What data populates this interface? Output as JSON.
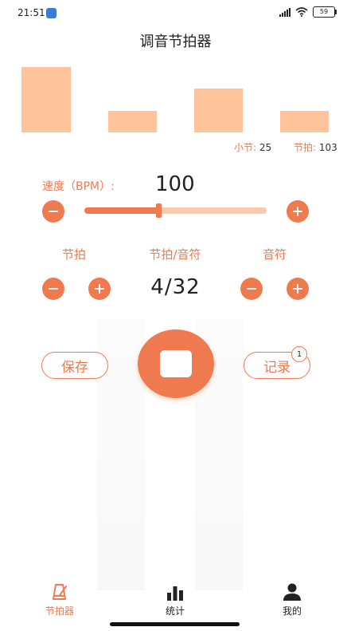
{
  "status_bar": {
    "time": "21:51",
    "battery": "59"
  },
  "page_title": "调音节拍器",
  "beat_bars": [
    {
      "level": 1.0
    },
    {
      "level": 0.33
    },
    {
      "level": 0.67
    },
    {
      "level": 0.33
    }
  ],
  "meta": {
    "measure_label": "小节:",
    "measure_value": "25",
    "beat_label": "节拍:",
    "beat_value": "103"
  },
  "speed": {
    "label": "速度（BPM）:",
    "value": "100",
    "slider_fraction": 0.41
  },
  "sections": {
    "beat_label": "节拍",
    "ratio_label": "节拍/音符",
    "note_label": "音符",
    "ratio_value": "4/32"
  },
  "actions": {
    "save_label": "保存",
    "record_label": "记录",
    "record_count": "1"
  },
  "tabs": [
    {
      "label": "节拍器",
      "icon": "metronome-icon",
      "active": true
    },
    {
      "label": "统计",
      "icon": "bar-chart-icon",
      "active": false
    },
    {
      "label": "我的",
      "icon": "person-icon",
      "active": false
    }
  ],
  "colors": {
    "accent": "#ef7a4f",
    "accent_light": "#ffc49b",
    "text": "#222222"
  }
}
